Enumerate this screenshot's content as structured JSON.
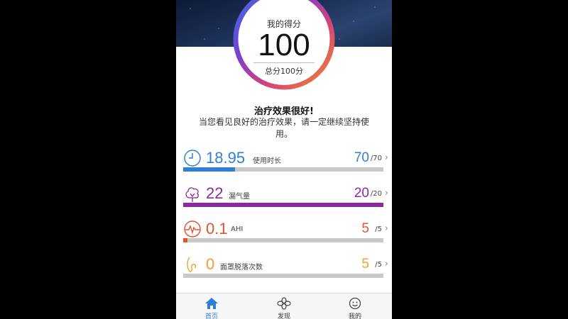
{
  "score": {
    "label": "我的得分",
    "value": "100",
    "total": "总分100分"
  },
  "message": {
    "title": "治疗效果很好!",
    "body": "当您看见良好的治疗效果，请一定继续坚持使用。"
  },
  "metrics": [
    {
      "value": "18.95",
      "name": "使用时长",
      "score": "70",
      "max": "/70",
      "fill_fraction": 0.26,
      "color": "#2f7fd9",
      "icon": "clock-icon"
    },
    {
      "value": "22",
      "name": "漏气量",
      "score": "20",
      "max": "/20",
      "fill_fraction": 1.0,
      "color": "#8a2a9e",
      "icon": "tree-leak-icon"
    },
    {
      "value": "0.1",
      "name": "AHI",
      "score": "5",
      "max": "/5",
      "fill_fraction": 0.02,
      "color": "#e0542d",
      "icon": "pulse-icon"
    },
    {
      "value": "0",
      "name": "面罩脱落次数",
      "score": "5",
      "max": "/5",
      "fill_fraction": 0.0,
      "color": "#f0a030",
      "icon": "mask-icon"
    }
  ],
  "tabs": [
    {
      "label": "首页",
      "icon": "home-icon",
      "active": true,
      "color": "#2f7fd9"
    },
    {
      "label": "发现",
      "icon": "flower-icon",
      "active": false
    },
    {
      "label": "我的",
      "icon": "smiley-icon",
      "active": false
    }
  ]
}
